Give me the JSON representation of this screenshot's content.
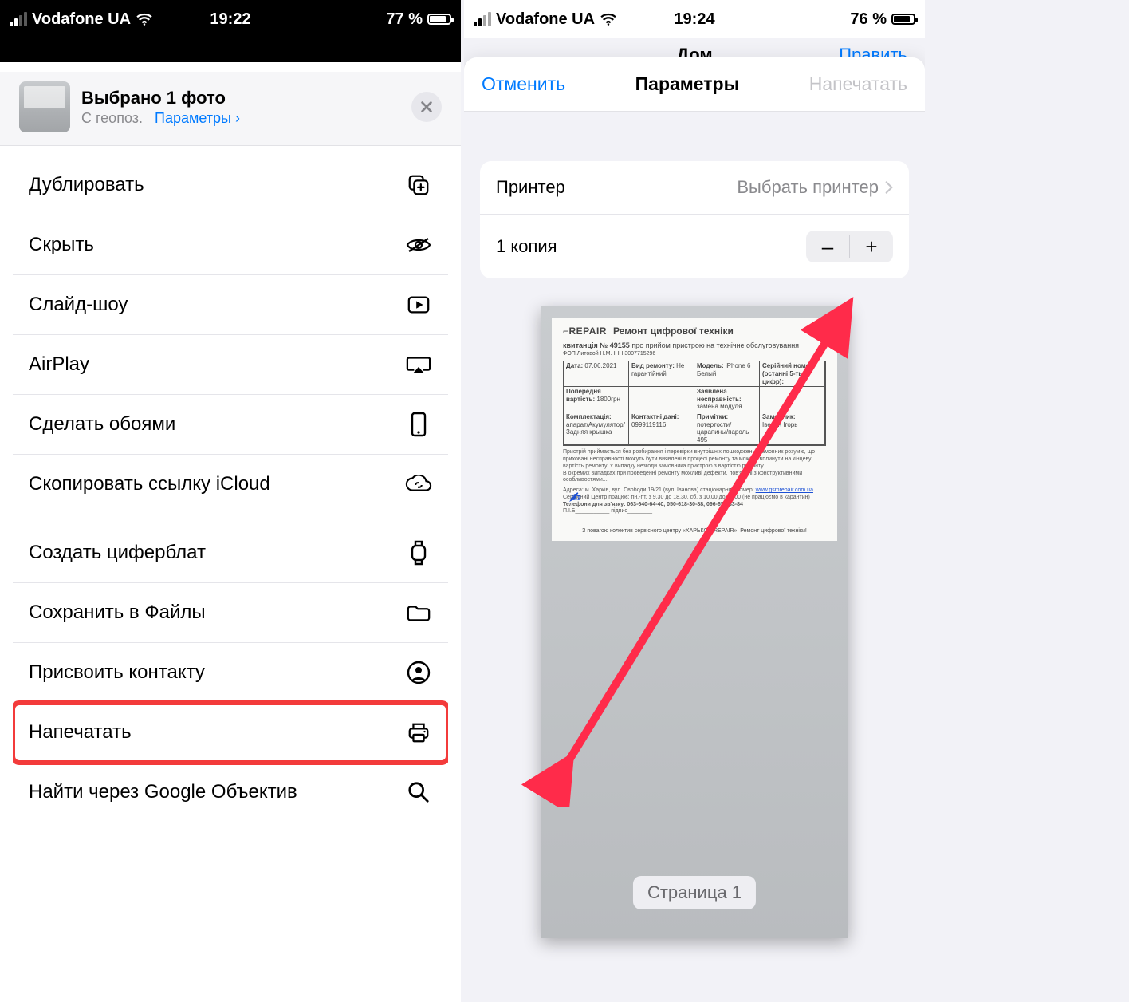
{
  "left": {
    "status": {
      "carrier": "Vodafone UA",
      "time": "19:22",
      "battery": "77 %"
    },
    "share_header": {
      "title": "Выбрано 1 фото",
      "subtitle_prefix": "С геопоз.",
      "subtitle_link": "Параметры",
      "chev": "›"
    },
    "group1": [
      {
        "label": "Дублировать",
        "icon": "duplicate-icon"
      },
      {
        "label": "Скрыть",
        "icon": "eye-off-icon"
      },
      {
        "label": "Слайд-шоу",
        "icon": "play-box-icon"
      },
      {
        "label": "AirPlay",
        "icon": "airplay-icon"
      },
      {
        "label": "Сделать обоями",
        "icon": "phone-icon"
      },
      {
        "label": "Скопировать ссылку iCloud",
        "icon": "cloud-link-icon"
      }
    ],
    "group2": [
      {
        "label": "Создать циферблат",
        "icon": "watch-icon"
      },
      {
        "label": "Сохранить в Файлы",
        "icon": "folder-icon"
      },
      {
        "label": "Присвоить контакту",
        "icon": "contact-icon"
      },
      {
        "label": "Напечатать",
        "icon": "printer-icon",
        "highlight": true
      },
      {
        "label": "Найти через Google Объектив",
        "icon": "search-icon"
      }
    ]
  },
  "right": {
    "status": {
      "carrier": "Vodafone UA",
      "time": "19:24",
      "battery": "76 %"
    },
    "under_title": "Дом",
    "edit": "Править",
    "nav": {
      "cancel": "Отменить",
      "title": "Параметры",
      "action": "Напечатать"
    },
    "printer": {
      "label": "Принтер",
      "value": "Выбрать принтер"
    },
    "copies": {
      "label": "1 копия",
      "minus": "–",
      "plus": "+"
    },
    "preview": {
      "doc_brand": "⌐REPAIR",
      "doc_title": "Ремонт цифрової техніки",
      "receipt_label": "квитанція №",
      "receipt_no": "49155",
      "receipt_suffix": "про прийом пристрою на технічне обслуговування",
      "fop": "ФОП Литовой Н.М. ІНН 3007715296",
      "date_label": "Дата:",
      "date": "07.06.2021",
      "repair_type_label": "Вид ремонту:",
      "repair_type": "Не гарантійний",
      "model_label": "Модель:",
      "model": "iPhone 6 Белый",
      "precost_label": "Попередня вартість:",
      "precost": "1800грн",
      "serial_label": "Серійний номер (останні 5-ть цифр):",
      "kit_label": "Комплектація:",
      "kit": "апарат/Акумулятор/Задняя крышка",
      "fault_label": "Заявлена несправність:",
      "fault": "замена модуля",
      "client_label": "Замовник:",
      "client": "Іверин Ігорь",
      "contact_label": "Контактні дані:",
      "contact": "0999119116",
      "note_label": "Примітки:",
      "note": "потертости/царапины/пароль 495",
      "address_prefix": "Адреса: м. Харків, вул. Свободи 19/21 (вул. Іванова) стаціонарний номер:",
      "url": "www.gsmrepair.com.ua",
      "schedule": "Сервісний Центр працює: пн.-пт. з 9.30 до 18.30, сб. з 10.00 до 16.00 (не працюємо в карантин)",
      "phones": "Телефони для зв'язку: 063-640-64-40, 050-618-30-88, 096-652-83-84",
      "sign_lines": "П.І.Б___________  підпис________",
      "thanks": "З повагою колектив сервісного центру «ХАРЬКОВ-REPAIR»! Ремонт цифрової техніки!",
      "page_badge": "Страница 1"
    }
  }
}
